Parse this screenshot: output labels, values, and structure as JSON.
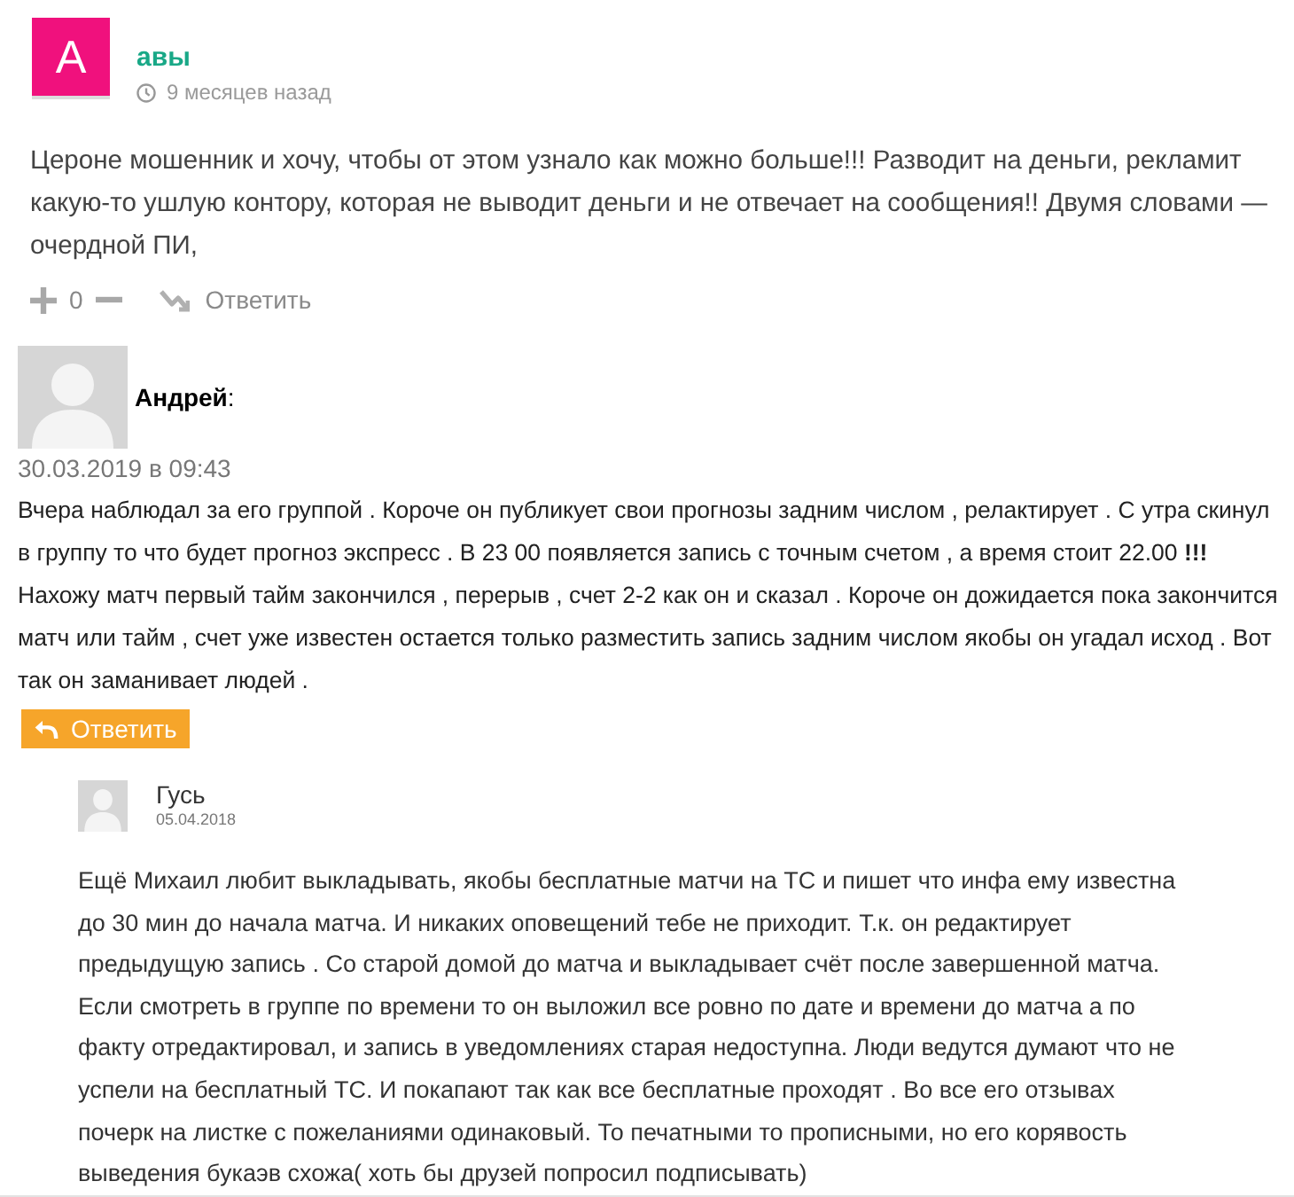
{
  "comments": [
    {
      "kind": "letter_avatar",
      "avatar_letter": "А",
      "author": "авы",
      "time": "9 месяцев назад",
      "text": "Цероне мошенник и хочу, чтобы от этом узнало как можно больше!!! Разводит на деньги, рекламит какую-то ушлую контору, которая не выводит деньги и не отвечает на сообщения!! Двумя словами — очердной ПИ,",
      "vote_count": "0",
      "reply_label": "Ответить"
    },
    {
      "kind": "classic",
      "author": "**Андрей**:",
      "date": "30.03.2019 в 09:43",
      "text": "Вчера наблюдал за его группой . Короче он публикует свои прогнозы задним числом , релактирует . С утра скинул в группу то что будет прогноз экспресс . В 23 00 появляется запись с точным счетом , а время стоит 22.00 **!!!** Нахожу матч первый тайм закончился , перерыв , счет 2-2 как он и сказал . Короче он дожидается пока закончится матч или тайм , счет уже известен остается только разместить запись задним числом якобы он угадал исход . Вот так он заманивает людей .",
      "reply_label": "Ответить"
    },
    {
      "kind": "nested",
      "author": "Гусь",
      "date": "05.04.2018",
      "text": "Ещё Михаил любит выкладывать, якобы бесплатные матчи на ТС и пишет что инфа ему известна до 30 мин до начала матча. И никаких оповещений тебе не приходит. Т.к. он редактирует предыдущую запись . Со старой домой до матча и выкладывает счёт после завершенной матча. Если смотреть в группе по времени то он выложил все ровно по дате и времени до матча а по факту отредактировал, и запись в уведомлениях старая недоступна. Люди ведутся думают что не успели на бесплатный ТС. И покапают так как все бесплатные проходят . Во все его отзывах почерк на листке с пожеланиями одинаковый. То печатными то прописными, но его корявость выведения букаэв схожа( хоть бы друзей попросил подписывать)"
    }
  ]
}
